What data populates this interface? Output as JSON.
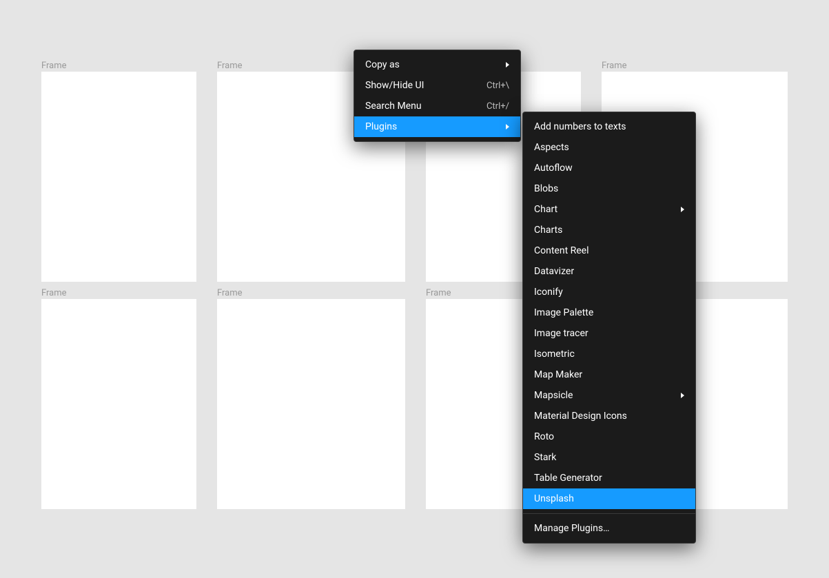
{
  "frames": {
    "row1": [
      {
        "label": "Frame"
      },
      {
        "label": "Frame"
      },
      {
        "label": ""
      },
      {
        "label": "Frame"
      }
    ],
    "row2": [
      {
        "label": "Frame"
      },
      {
        "label": "Frame"
      },
      {
        "label": "Frame"
      },
      {
        "label": ""
      }
    ]
  },
  "contextMenu": {
    "items": [
      {
        "label": "Copy as",
        "shortcut": "",
        "submenu": true,
        "selected": false
      },
      {
        "label": "Show/Hide UI",
        "shortcut": "Ctrl+\\",
        "submenu": false,
        "selected": false
      },
      {
        "label": "Search Menu",
        "shortcut": "Ctrl+/",
        "submenu": false,
        "selected": false
      },
      {
        "label": "Plugins",
        "shortcut": "",
        "submenu": true,
        "selected": true
      }
    ]
  },
  "pluginsSubmenu": {
    "items": [
      {
        "label": "Add numbers to texts",
        "submenu": false,
        "selected": false
      },
      {
        "label": "Aspects",
        "submenu": false,
        "selected": false
      },
      {
        "label": "Autoflow",
        "submenu": false,
        "selected": false
      },
      {
        "label": "Blobs",
        "submenu": false,
        "selected": false
      },
      {
        "label": "Chart",
        "submenu": true,
        "selected": false
      },
      {
        "label": "Charts",
        "submenu": false,
        "selected": false
      },
      {
        "label": "Content Reel",
        "submenu": false,
        "selected": false
      },
      {
        "label": "Datavizer",
        "submenu": false,
        "selected": false
      },
      {
        "label": "Iconify",
        "submenu": false,
        "selected": false
      },
      {
        "label": "Image Palette",
        "submenu": false,
        "selected": false
      },
      {
        "label": "Image tracer",
        "submenu": false,
        "selected": false
      },
      {
        "label": "Isometric",
        "submenu": false,
        "selected": false
      },
      {
        "label": "Map Maker",
        "submenu": false,
        "selected": false
      },
      {
        "label": "Mapsicle",
        "submenu": true,
        "selected": false
      },
      {
        "label": "Material Design Icons",
        "submenu": false,
        "selected": false
      },
      {
        "label": "Roto",
        "submenu": false,
        "selected": false
      },
      {
        "label": "Stark",
        "submenu": false,
        "selected": false
      },
      {
        "label": "Table Generator",
        "submenu": false,
        "selected": false
      },
      {
        "label": "Unsplash",
        "submenu": false,
        "selected": true
      }
    ],
    "footer": {
      "label": "Manage Plugins…"
    }
  }
}
